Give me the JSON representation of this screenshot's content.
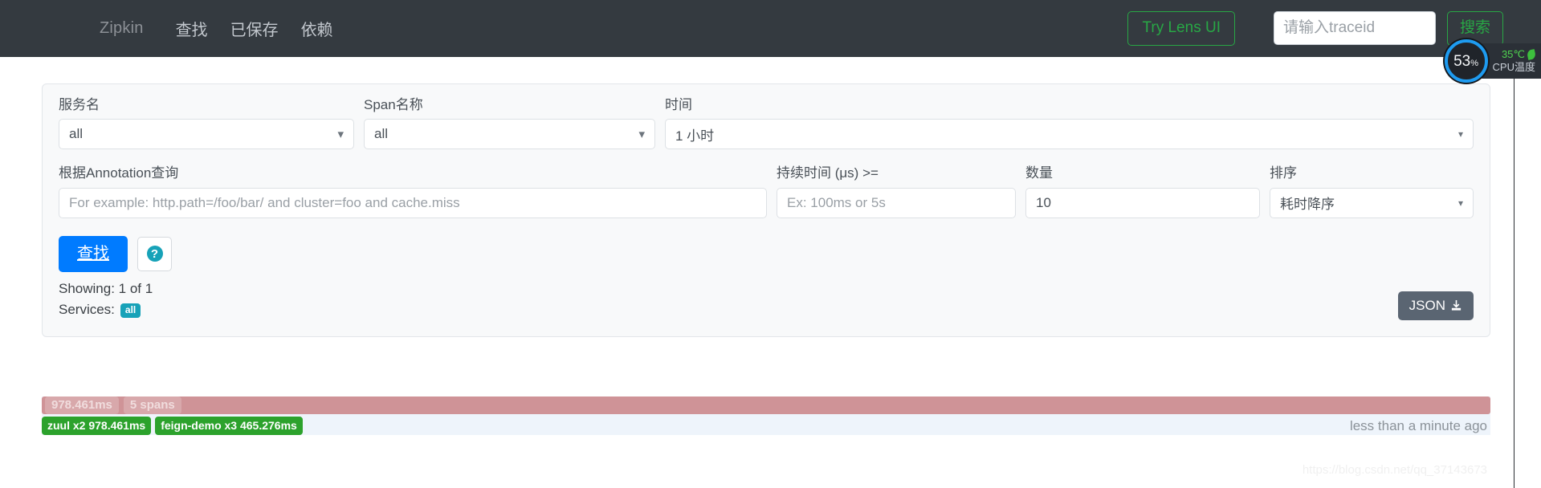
{
  "navbar": {
    "brand": "Zipkin",
    "links": [
      {
        "label": "查找"
      },
      {
        "label": "已保存"
      },
      {
        "label": "依赖"
      }
    ],
    "lens_button": "Try Lens UI",
    "traceid_placeholder": "请输入traceid",
    "traceid_value": "",
    "search_button": "搜索",
    "accent_green": "#28a745",
    "background": "#343a40"
  },
  "search_form": {
    "service_name": {
      "label": "服务名",
      "value": "all",
      "icon": "chevron-down-icon"
    },
    "span_name": {
      "label": "Span名称",
      "value": "all",
      "icon": "chevron-down-icon"
    },
    "time": {
      "label": "时间",
      "value": "1 小时",
      "icon": "chevron-down-icon"
    },
    "annotation": {
      "label": "根据Annotation查询",
      "value": "",
      "placeholder": "For example: http.path=/foo/bar/ and cluster=foo and cache.miss"
    },
    "duration": {
      "label": "持续时间 (μs) >=",
      "value": "",
      "placeholder": "Ex: 100ms or 5s"
    },
    "limit": {
      "label": "数量",
      "value": "10",
      "placeholder": ""
    },
    "sort": {
      "label": "排序",
      "value": "耗时降序",
      "icon": "chevron-down-icon"
    },
    "find_button": "查找",
    "help_button": "?",
    "help_icon": "question-circle-icon",
    "showing": "Showing: 1 of 1",
    "services_label": "Services:",
    "services_badges": [
      "all"
    ],
    "json_button": "JSON",
    "json_icon": "download-icon",
    "primary_color": "#007bff",
    "badge_color": "#17a2b8"
  },
  "results": {
    "traces": [
      {
        "duration": "978.461ms",
        "spans": "5 spans",
        "services": [
          "zuul x2 978.461ms",
          "feign-demo x3 465.276ms"
        ],
        "timestamp": "less than a minute ago",
        "bar_width_pct": 100,
        "bar_color": "#cf9397",
        "service_color": "#2ca22c"
      }
    ]
  },
  "cpu_widget": {
    "percent": "53",
    "percent_unit": "%",
    "temperature": "35℃",
    "label": "CPU温度",
    "leaf_icon": "leaf-icon",
    "ring_color": "#1e9bf0",
    "temp_color": "#4fd14f"
  },
  "watermark": {
    "text": "https://blog.csdn.net/qq_37143673"
  }
}
